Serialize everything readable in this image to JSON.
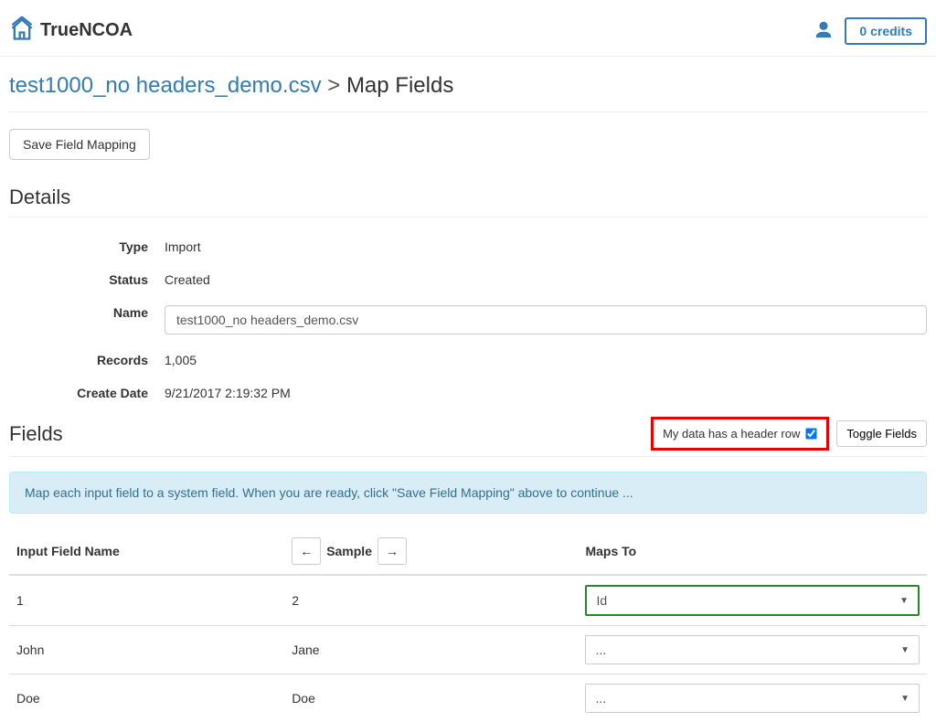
{
  "header": {
    "logo_text": "TrueNCOA",
    "credits_label": "0 credits"
  },
  "breadcrumb": {
    "file_name": "test1000_no headers_demo.csv",
    "separator": ">",
    "page_title": "Map Fields"
  },
  "buttons": {
    "save_mapping": "Save Field Mapping",
    "toggle_fields": "Toggle Fields"
  },
  "details": {
    "section_title": "Details",
    "type_label": "Type",
    "type_value": "Import",
    "status_label": "Status",
    "status_value": "Created",
    "name_label": "Name",
    "name_value": "test1000_no headers_demo.csv",
    "records_label": "Records",
    "records_value": "1,005",
    "create_date_label": "Create Date",
    "create_date_value": "9/21/2017 2:19:32 PM"
  },
  "fields": {
    "section_title": "Fields",
    "header_row_label": "My data has a header row",
    "info_message": "Map each input field to a system field. When you are ready, click \"Save Field Mapping\" above to continue ...",
    "columns": {
      "input_field": "Input Field Name",
      "sample": "Sample",
      "maps_to": "Maps To"
    },
    "rows": [
      {
        "input": "1",
        "sample": "2",
        "maps_to": "Id",
        "highlight": true
      },
      {
        "input": "John",
        "sample": "Jane",
        "maps_to": "...",
        "highlight": false
      },
      {
        "input": "Doe",
        "sample": "Doe",
        "maps_to": "...",
        "highlight": false
      }
    ]
  }
}
